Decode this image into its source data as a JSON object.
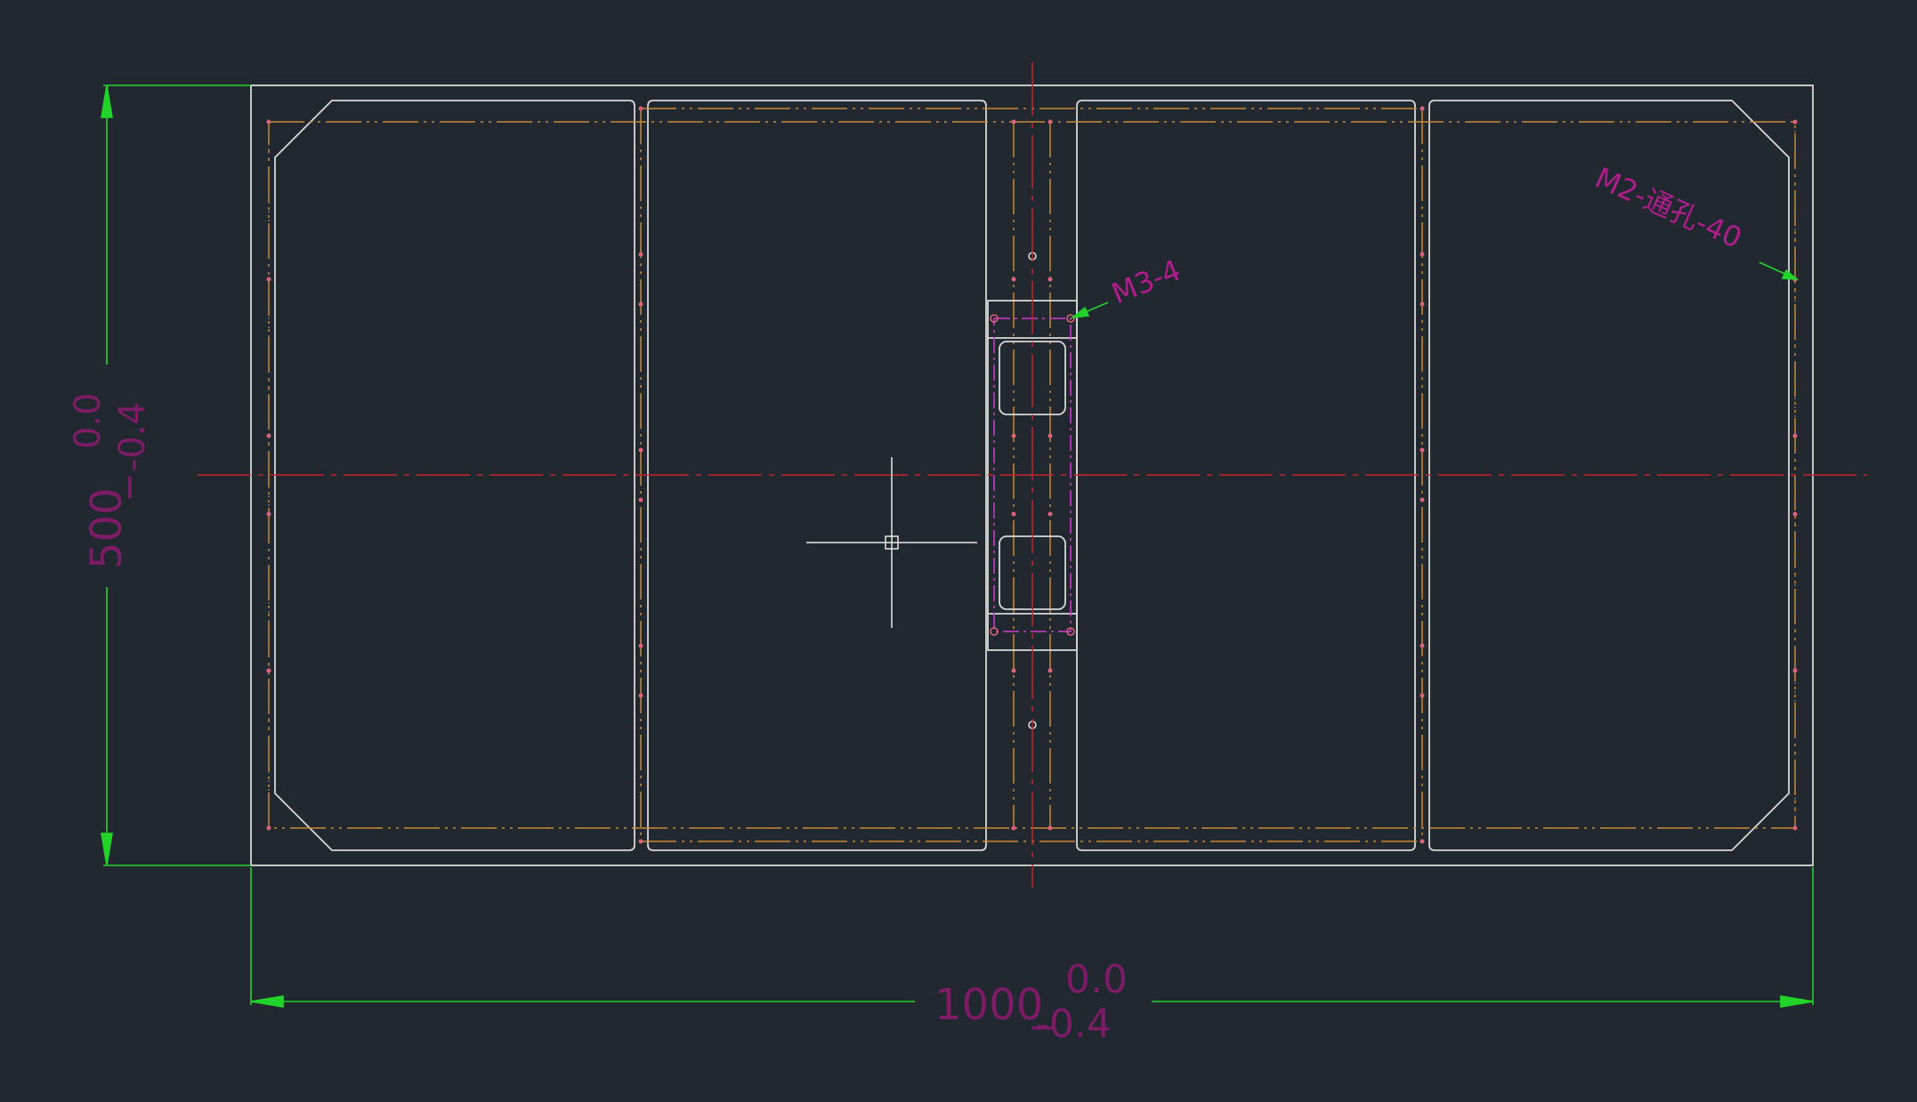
{
  "dimensions": {
    "width": {
      "main": "1000",
      "upper_tol": "0.0",
      "lower_tol": "-0.4",
      "prefix": "_"
    },
    "height": {
      "main": "500",
      "upper_tol": "0.0",
      "lower_tol": "-0.4",
      "prefix": "_"
    }
  },
  "callouts": {
    "m3": "M3-4",
    "m2": "M2-通孔-40"
  },
  "colors": {
    "background": "#212830",
    "outline": "#d8d8d8",
    "centerline": "#c8232b",
    "dimension": "#22d42a",
    "dim_text": "#7e1b66",
    "hidden_line": "#c98a34",
    "hole": "#e0607a",
    "magenta": "#d13ad0"
  }
}
